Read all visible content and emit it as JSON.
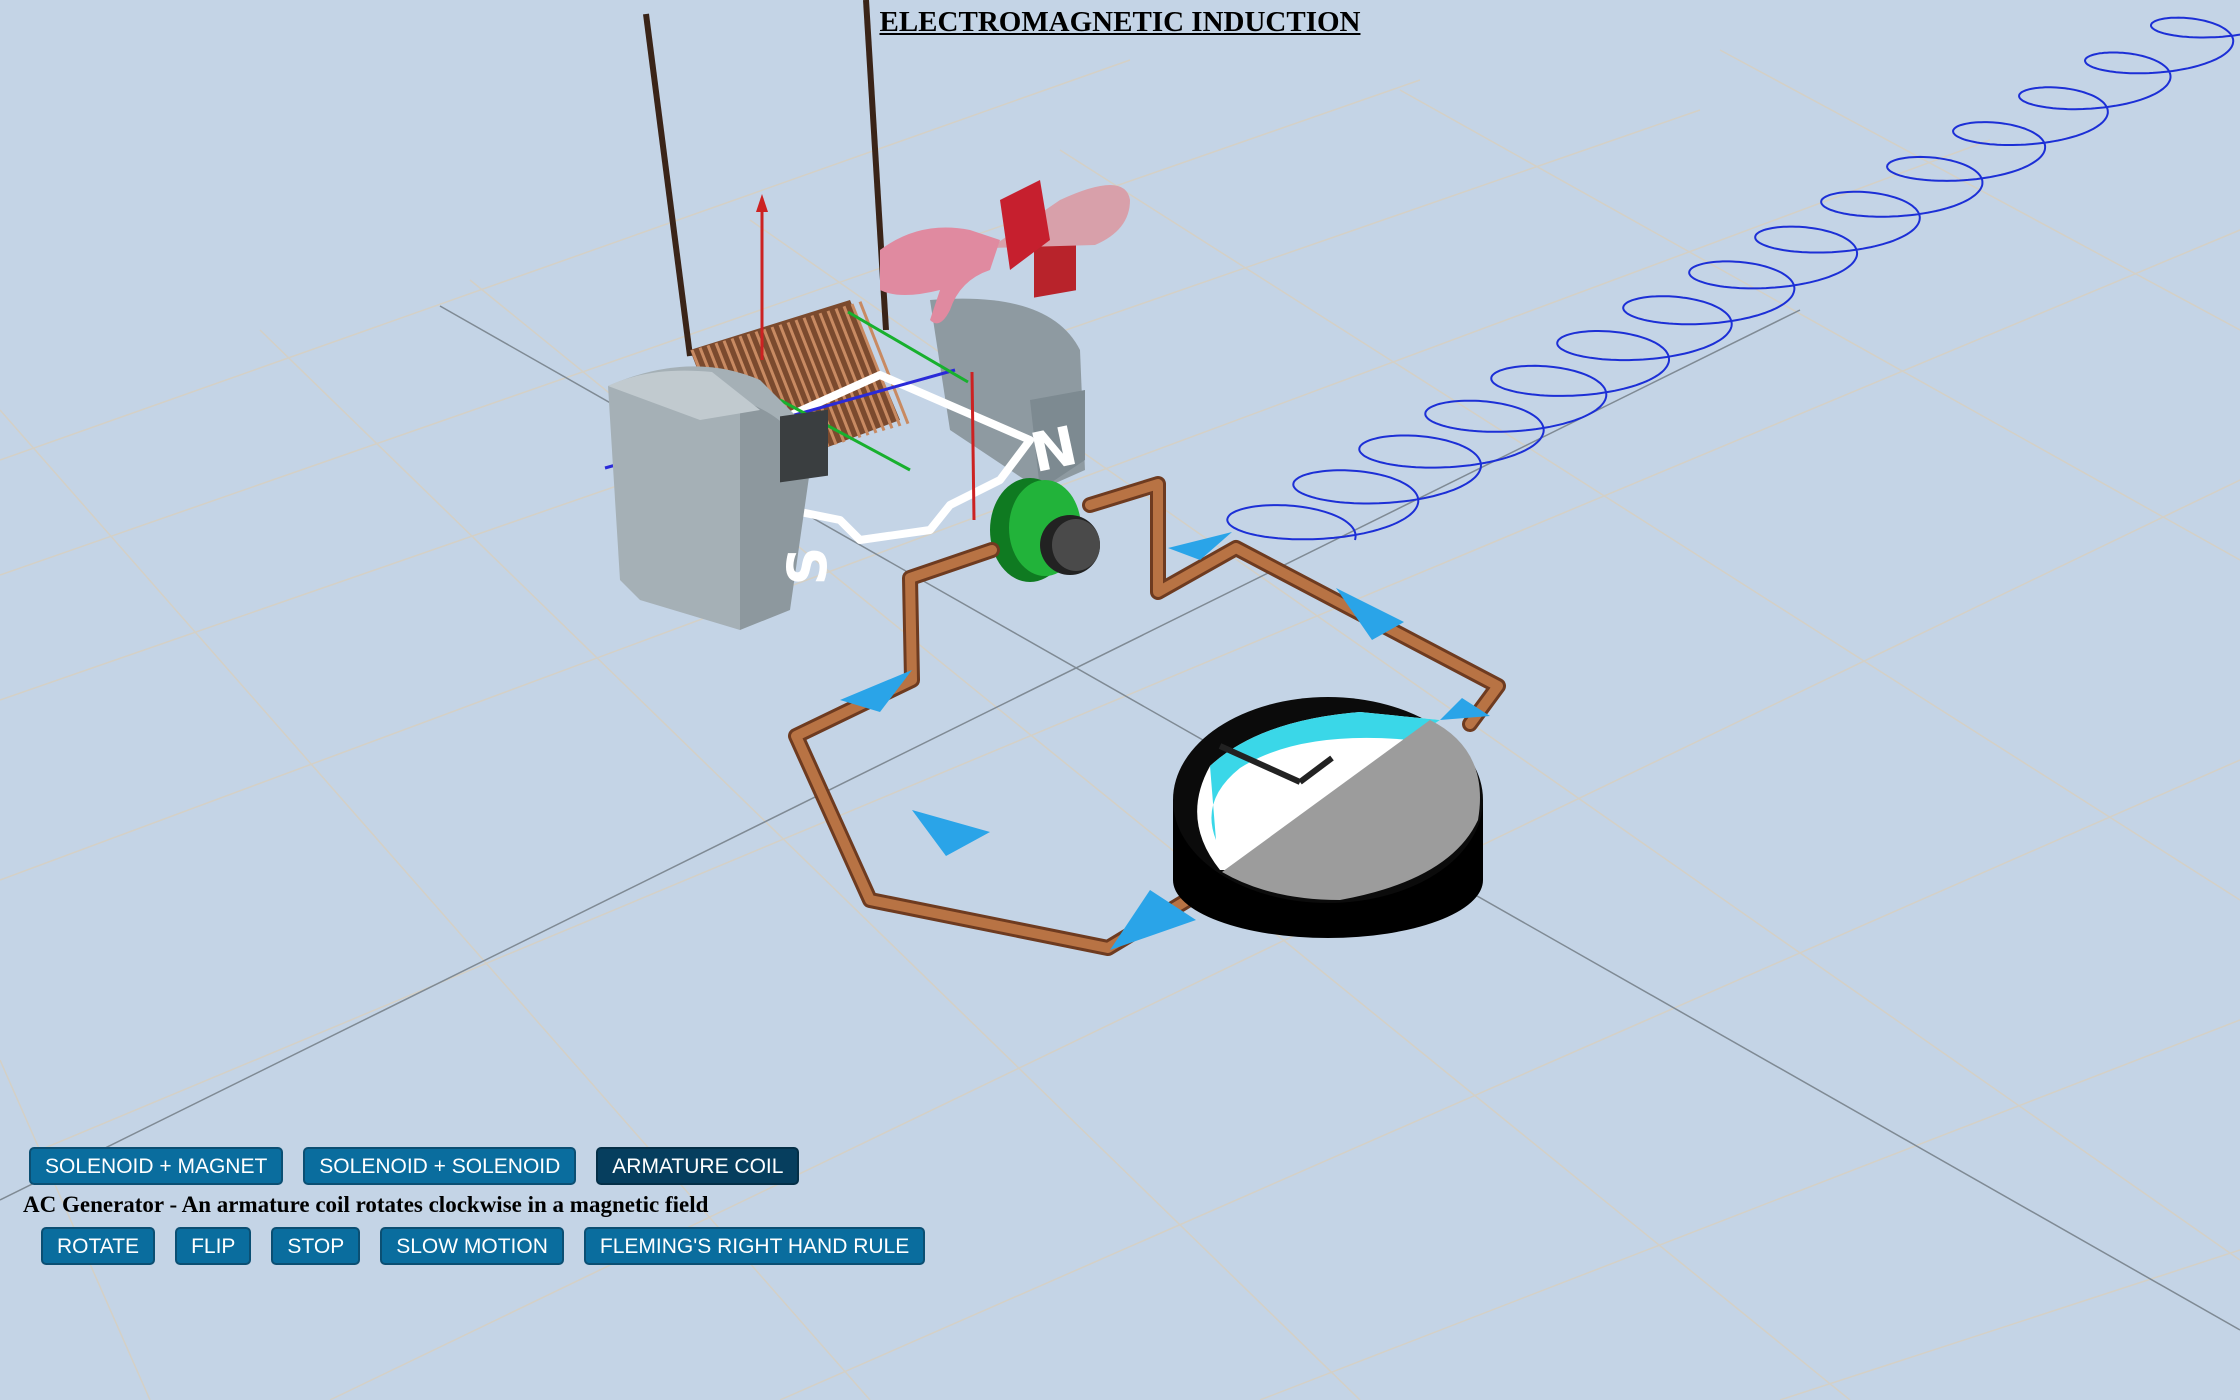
{
  "title": "ELECTROMAGNETIC INDUCTION",
  "mode_buttons": [
    {
      "label": "SOLENOID + MAGNET",
      "active": false
    },
    {
      "label": "SOLENOID + SOLENOID",
      "active": false
    },
    {
      "label": "ARMATURE COIL",
      "active": true
    }
  ],
  "caption": "AC Generator - An armature coil rotates clockwise in a magnetic field",
  "control_buttons": [
    {
      "label": "ROTATE"
    },
    {
      "label": "FLIP"
    },
    {
      "label": "STOP"
    },
    {
      "label": "SLOW MOTION"
    },
    {
      "label": "FLEMING'S RIGHT HAND RULE"
    }
  ],
  "magnet_labels": {
    "south": "S",
    "north": "N"
  },
  "colors": {
    "background": "#c4d4e6",
    "button": "#0a6d9e",
    "button_active": "#063e5e",
    "copper_wire": "#b87344",
    "arrow": "#2aa4e8",
    "wave": "#1c2fd6",
    "magnet_body": "#9aa6ad",
    "commutator_green": "#22b33a"
  }
}
